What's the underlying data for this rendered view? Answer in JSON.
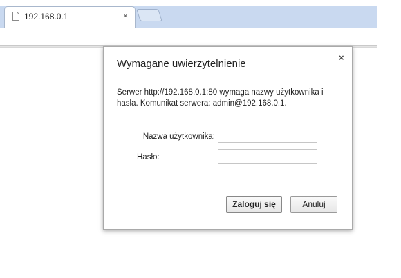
{
  "browser": {
    "tab": {
      "title": "192.168.0.1",
      "close_symbol": "×"
    }
  },
  "dialog": {
    "title": "Wymagane uwierzytelnienie",
    "close_symbol": "×",
    "message": "Serwer http://192.168.0.1:80 wymaga nazwy użytkownika i hasła. Komunikat serwera: admin@192.168.0.1.",
    "username_label": "Nazwa użytkownika:",
    "password_label": "Hasło:",
    "username_value": "",
    "password_value": "",
    "login_button": "Zaloguj się",
    "cancel_button": "Anuluj"
  }
}
